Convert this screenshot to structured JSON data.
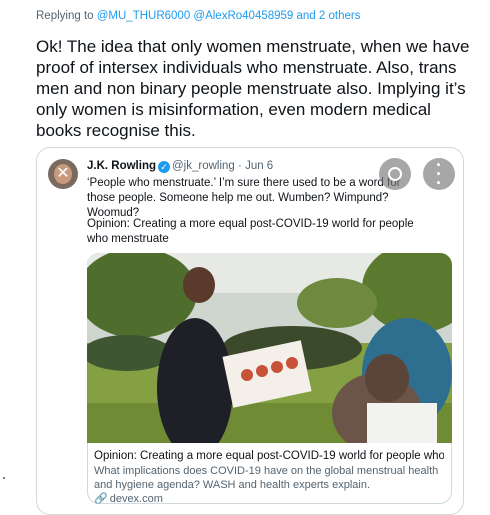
{
  "reply": {
    "prefix": "Replying to ",
    "mentions": "@MU_THUR6000 @AlexRo40458959 and 2 others"
  },
  "tweet": {
    "text": "Ok! The idea that only women menstruate, when we have proof of intersex individuals who menstruate. Also, trans men and non binary people menstruate also. Implying it’s only women is misinformation, even modern medical books recognise this."
  },
  "quoted_tweet": {
    "name": "J.K. Rowling",
    "verified_icon": "verified-badge-icon",
    "handle": "@jk_rowling",
    "separator": "·",
    "date": "Jun 6",
    "text": "‘People who menstruate.’ I’m sure there used to be a word for those people. Someone help me out. Wumben? Wimpund? Woomud?",
    "link_title": "Opinion: Creating a more equal post-COVID-19 world for people who menstruate"
  },
  "link_card": {
    "title": "Opinion: Creating a more equal post-COVID-19 world for people who...",
    "description": "What implications does COVID-19 have on the global menstrual health and hygiene agenda? WASH and health experts explain.",
    "domain": "devex.com",
    "domain_icon": "link-icon"
  },
  "overlay_buttons": {
    "lens_icon": "lens-search-icon",
    "more_icon": "more-vertical-icon"
  },
  "colors": {
    "accent": "#1d9bf0",
    "text": "#0f1419",
    "muted": "#536471",
    "border": "#cfd9de"
  }
}
